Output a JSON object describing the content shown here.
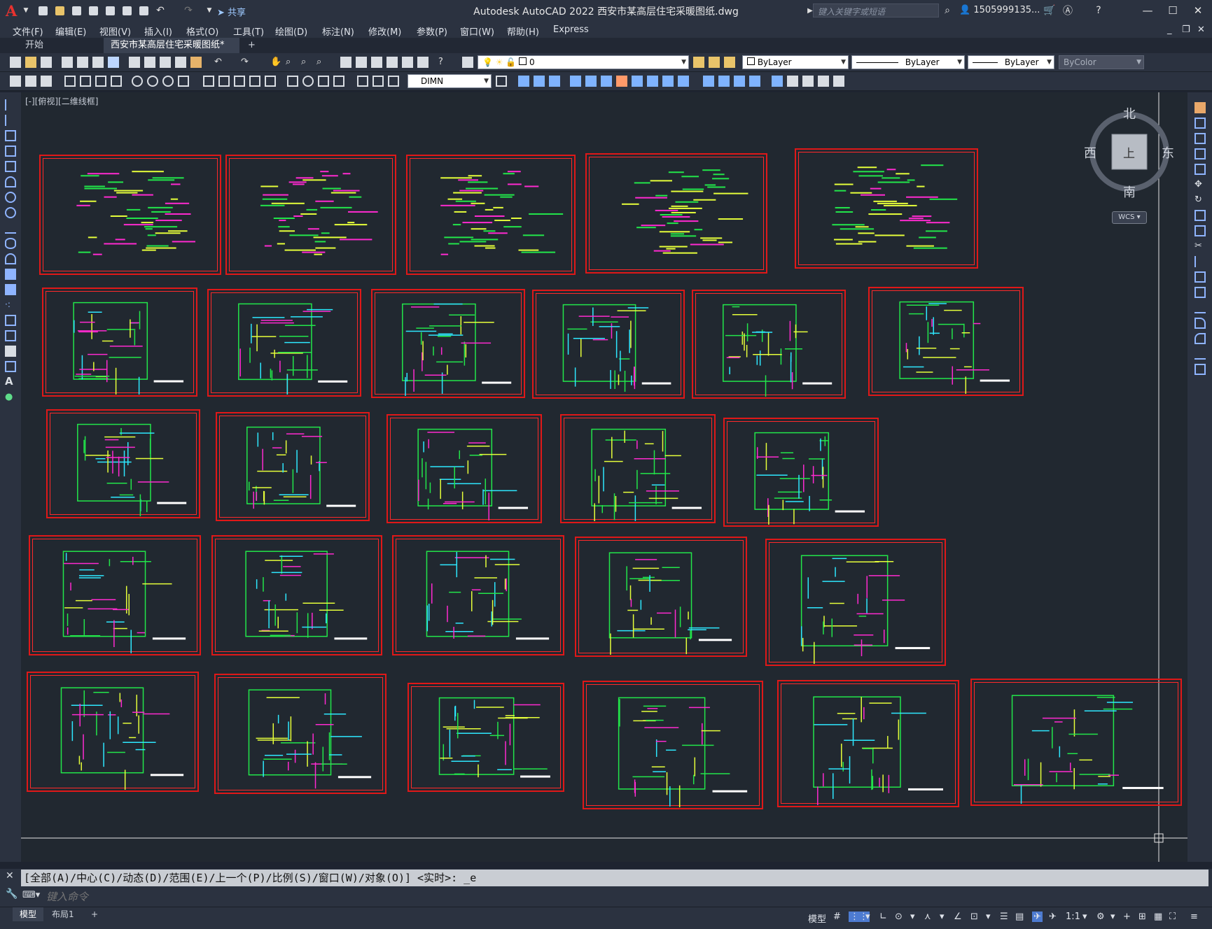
{
  "app": {
    "title": "Autodesk AutoCAD 2022    西安市某高层住宅采暖图纸.dwg",
    "share_label": "共享",
    "search_placeholder": "键入关键字或短语",
    "user": "1505999135...",
    "logo_letter": "A"
  },
  "menu": [
    "文件(F)",
    "编辑(E)",
    "视图(V)",
    "插入(I)",
    "格式(O)",
    "工具(T)",
    "绘图(D)",
    "标注(N)",
    "修改(M)",
    "参数(P)",
    "窗口(W)",
    "帮助(H)",
    "Express"
  ],
  "tabs": [
    {
      "label": "开始",
      "active": false
    },
    {
      "label": "西安市某高层住宅采暖图纸*",
      "active": true
    }
  ],
  "toolbar": {
    "layer_value": "0",
    "color_value": "ByLayer",
    "linetype_value": "ByLayer",
    "lineweight_value": "ByLayer",
    "plotstyle_value": "ByColor",
    "dimstyle_value": "DIMN"
  },
  "viewport": {
    "label": "[-][俯视][二维线框]",
    "compass": {
      "north": "北",
      "south": "南",
      "east": "东",
      "west": "西",
      "top": "上"
    },
    "wcs": "WCS"
  },
  "command": {
    "history": "[全部(A)/中心(C)/动态(D)/范围(E)/上一个(P)/比例(S)/窗口(W)/对象(O)] <实时>: _e",
    "placeholder": "键入命令"
  },
  "layouts": [
    {
      "label": "模型",
      "active": true
    },
    {
      "label": "布局1",
      "active": false
    }
  ],
  "status": {
    "model_label": "模型",
    "scale": "1:1"
  },
  "colors": {
    "sheet_border": "#e01818",
    "canvas_bg": "#212830",
    "ui_bg": "#2b3240"
  }
}
